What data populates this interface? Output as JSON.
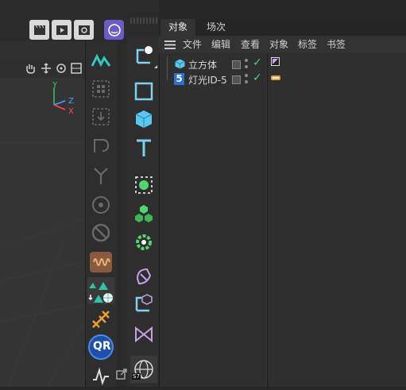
{
  "tabs": [
    "对象",
    "场次"
  ],
  "menu": [
    "文件",
    "编辑",
    "查看",
    "对象",
    "标签",
    "书签"
  ],
  "objects": [
    {
      "name": "立方体",
      "icon": "cube-icon"
    },
    {
      "name": "灯光ID-5",
      "icon": "light-id-5-icon",
      "badge": "5"
    }
  ],
  "viewport": {
    "axis_y": "Y",
    "axis_z": "Z",
    "axis_x": "X"
  },
  "colors": {
    "accent_green": "#4ad27b",
    "selection_blue": "#2d6fd6",
    "icon_blue": "#58c8f0",
    "icon_green": "#52d66a",
    "icon_purple": "#c8a0e8",
    "icon_orange": "#e8a030"
  },
  "tools_left": [
    "motion-tracker-icon",
    "group-icon",
    "drop-icon",
    "rotate-axis-icon",
    "split-icon",
    "target-icon",
    "ban-icon",
    "wave-icon",
    "terrain-icon",
    "scissors-icon",
    "qr-icon",
    "spline-icon"
  ],
  "tools_right": [
    "null-object-icon",
    "square-spline-icon",
    "cube-primitive-icon",
    "text-icon",
    "generator-icon",
    "cloner-icon",
    "gear-effector-icon",
    "deformer-icon",
    "transform-icon",
    "field-icon",
    "globe-icon"
  ],
  "qr_label": "QR",
  "globe_badge": "S7"
}
